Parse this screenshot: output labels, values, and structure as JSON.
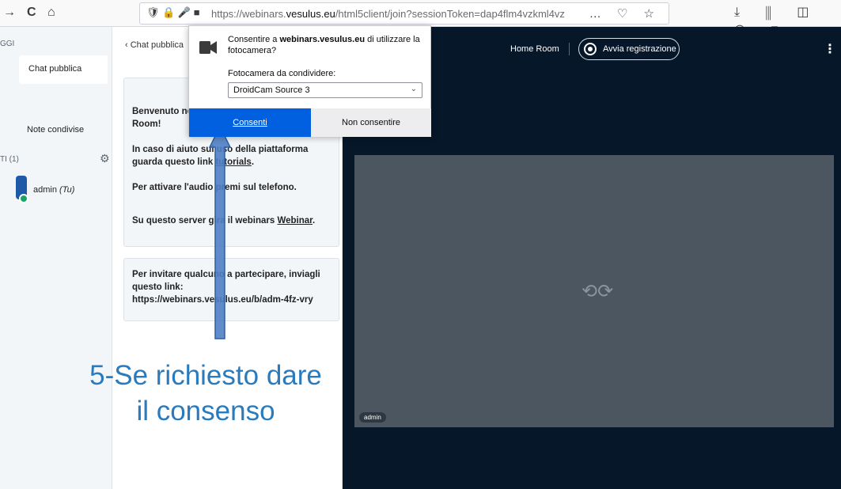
{
  "browser": {
    "url_domain": "https://webinars.",
    "url_host": "vesulus.eu",
    "url_path": "/html5client/join?sessionToken=dap4flm4vzkml4vz",
    "nav": {
      "back": "→",
      "reload": "C",
      "home": "⌂"
    },
    "url_actions": "… ♡ ☆",
    "toolbar_right": "⤓ ⫼ ◫ ◉ ≡"
  },
  "sidebar": {
    "messages_heading": "GGI",
    "public_chat": "Chat pubblica",
    "shared_notes": "Note condivise",
    "users_heading": "TI (1)",
    "gear": "⚙",
    "user_name": "admin",
    "user_tag": "(Tu)"
  },
  "chat": {
    "back_label": "Chat pubblica",
    "welcome_1": "Benvenuto nel",
    "welcome_1_bold": "Room!",
    "help_text": "In caso di aiuto sul uso della piattaforma guarda questo link",
    "help_link": "tutorials",
    "audio_text": "Per attivare l'audio premi sul telefono.",
    "server_text": "Su questo server gira il webinars",
    "server_link": "Webinar",
    "invite_text": "Per invitare qualcuno a partecipare, inviagli questo link: https://webinars.vesulus.eu/b/adm-4fz-vry"
  },
  "annotation": {
    "text": "5-Se richiesto dare il consenso",
    "color": "#2a7bbd"
  },
  "main": {
    "room_name": "Home Room",
    "record_label": "Avvia registrazione",
    "menu": "⋮",
    "video_user": "admin",
    "sync_icon": "⟲⟳"
  },
  "permission": {
    "prompt_pre": "Consentire a ",
    "prompt_site": "webinars.vesulus.eu",
    "prompt_post": " di utilizzare la fotocamera?",
    "share_label": "Fotocamera da condividere:",
    "camera_selected": "DroidCam Source 3",
    "allow": "Consenti",
    "deny": "Non consentire",
    "allow_color": "#0060df"
  }
}
